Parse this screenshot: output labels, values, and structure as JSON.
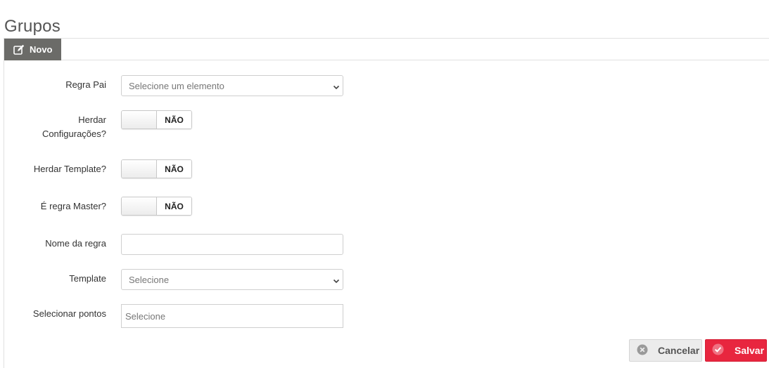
{
  "page": {
    "title": "Grupos"
  },
  "tabs": {
    "novo_label": "Novo"
  },
  "form": {
    "regra_pai": {
      "label": "Regra Pai",
      "placeholder": "Selecione um elemento"
    },
    "herdar_configuracoes": {
      "label_line1": "Herdar",
      "label_line2": "Configurações?",
      "state": "NÃO"
    },
    "herdar_template": {
      "label": "Herdar Template?",
      "state": "NÃO"
    },
    "regra_master": {
      "label": "É regra Master?",
      "state": "NÃO"
    },
    "nome_regra": {
      "label": "Nome da regra",
      "value": ""
    },
    "template": {
      "label": "Template",
      "placeholder": "Selecione"
    },
    "selecionar_pontos": {
      "label": "Selecionar pontos",
      "placeholder": "Selecione"
    }
  },
  "actions": {
    "cancel_label": "Cancelar",
    "save_label": "Salvar"
  },
  "colors": {
    "tab_bg": "#6b6b68",
    "save_bg": "#e8263f",
    "cancel_bg": "#ececec"
  },
  "icons": {
    "tab": "edit-icon",
    "cancel": "close-circle-icon",
    "save": "check-circle-icon",
    "select": "chevron-down-icon"
  }
}
